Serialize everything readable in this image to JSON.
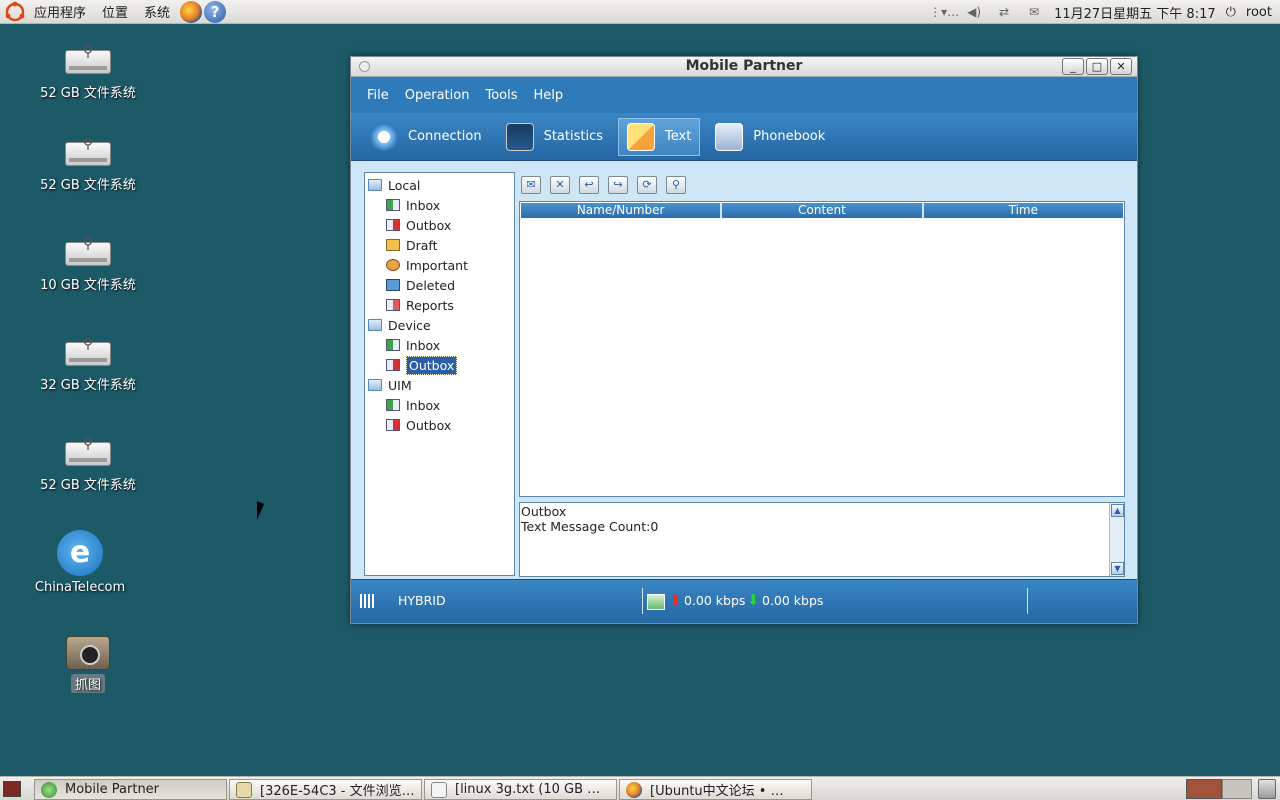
{
  "top_panel": {
    "menus": [
      "应用程序",
      "位置",
      "系统"
    ],
    "clock": "11月27日星期五 下午 8:17",
    "user": "root"
  },
  "desktop": {
    "icons": [
      {
        "label": "52 GB 文件系统",
        "icon": "usb-drive-icon"
      },
      {
        "label": "52 GB 文件系统",
        "icon": "usb-drive-icon"
      },
      {
        "label": "10 GB 文件系统",
        "icon": "usb-drive-icon"
      },
      {
        "label": "32 GB 文件系统",
        "icon": "usb-drive-icon"
      },
      {
        "label": "52 GB 文件系统",
        "icon": "usb-drive-icon"
      },
      {
        "label": "ChinaTelecom",
        "icon": "china-telecom-icon"
      },
      {
        "label": "抓图",
        "icon": "camera-icon"
      }
    ]
  },
  "window": {
    "title": "Mobile Partner",
    "menu": [
      "File",
      "Operation",
      "Tools",
      "Help"
    ],
    "toolbar": [
      {
        "label": "Connection",
        "icon": "connection-icon"
      },
      {
        "label": "Statistics",
        "icon": "statistics-icon"
      },
      {
        "label": "Text",
        "icon": "text-icon",
        "active": true
      },
      {
        "label": "Phonebook",
        "icon": "phonebook-icon"
      }
    ],
    "tree": {
      "local": {
        "label": "Local",
        "items": [
          "Inbox",
          "Outbox",
          "Draft",
          "Important",
          "Deleted",
          "Reports"
        ]
      },
      "device": {
        "label": "Device",
        "items": [
          "Inbox",
          "Outbox"
        ],
        "selected": "Outbox"
      },
      "uim": {
        "label": "UIM",
        "items": [
          "Inbox",
          "Outbox"
        ]
      }
    },
    "message_toolbar": [
      "new-message-icon",
      "delete-message-icon",
      "reply-icon",
      "forward-icon",
      "resend-icon",
      "search-icon"
    ],
    "table": {
      "columns": [
        "Name/Number",
        "Content",
        "Time"
      ],
      "rows": []
    },
    "info": {
      "line1": "Outbox",
      "line2": "Text Message Count:0"
    },
    "status": {
      "network_mode": "HYBRID",
      "upload": "0.00 kbps",
      "download": "0.00 kbps"
    }
  },
  "taskbar": {
    "tasks": [
      {
        "label": "Mobile Partner",
        "active": true
      },
      {
        "label": "[326E-54C3 - 文件浏览…",
        "active": false
      },
      {
        "label": "[linux 3g.txt (10 GB …",
        "active": false
      },
      {
        "label": "[Ubuntu中文论坛 • …",
        "active": false
      }
    ]
  },
  "colors": {
    "desktop_bg": "#1d5a68",
    "app_blue": "#2f7ab8",
    "content_bg": "#cfe6f6",
    "selection": "#2a5ea8",
    "upload_arrow": "#e23030",
    "download_arrow": "#2fd03a"
  }
}
